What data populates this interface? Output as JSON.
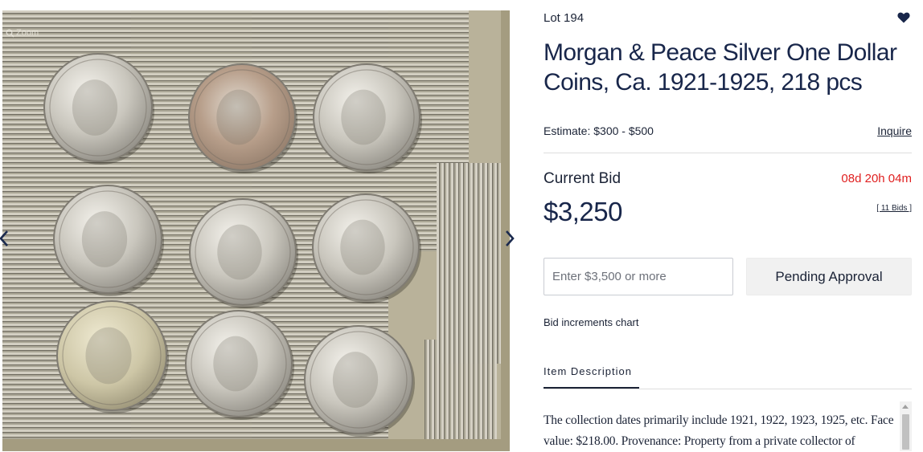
{
  "gallery": {
    "zoom_label": "Zoom",
    "image_alt": "Morgan and Peace silver dollar coins in a box"
  },
  "lot": {
    "label": "Lot 194",
    "title": "Morgan & Peace Silver One Dollar Coins, Ca. 1921-1925, 218 pcs",
    "estimate": "Estimate: $300 - $500",
    "inquire": "Inquire"
  },
  "bidding": {
    "current_bid_label": "Current Bid",
    "time_left": "08d 20h 04m",
    "amount": "$3,250",
    "bids_link": "[ 11 Bids ]",
    "input_placeholder": "Enter $3,500 or more",
    "pending_button": "Pending Approval",
    "increments_link": "Bid increments chart"
  },
  "tabs": {
    "description_label": "Item Description"
  },
  "description": {
    "text": "The collection dates primarily include 1921, 1922, 1923, 1925, etc. Face value: $218.00. Provenance: Property from a private collector of"
  },
  "colors": {
    "title_navy": "#18264a",
    "timer_red": "#e02020",
    "button_grey": "#f1f1f1"
  },
  "icons": [
    "zoom-icon",
    "chevron-left-icon",
    "chevron-right-icon",
    "heart-icon"
  ]
}
